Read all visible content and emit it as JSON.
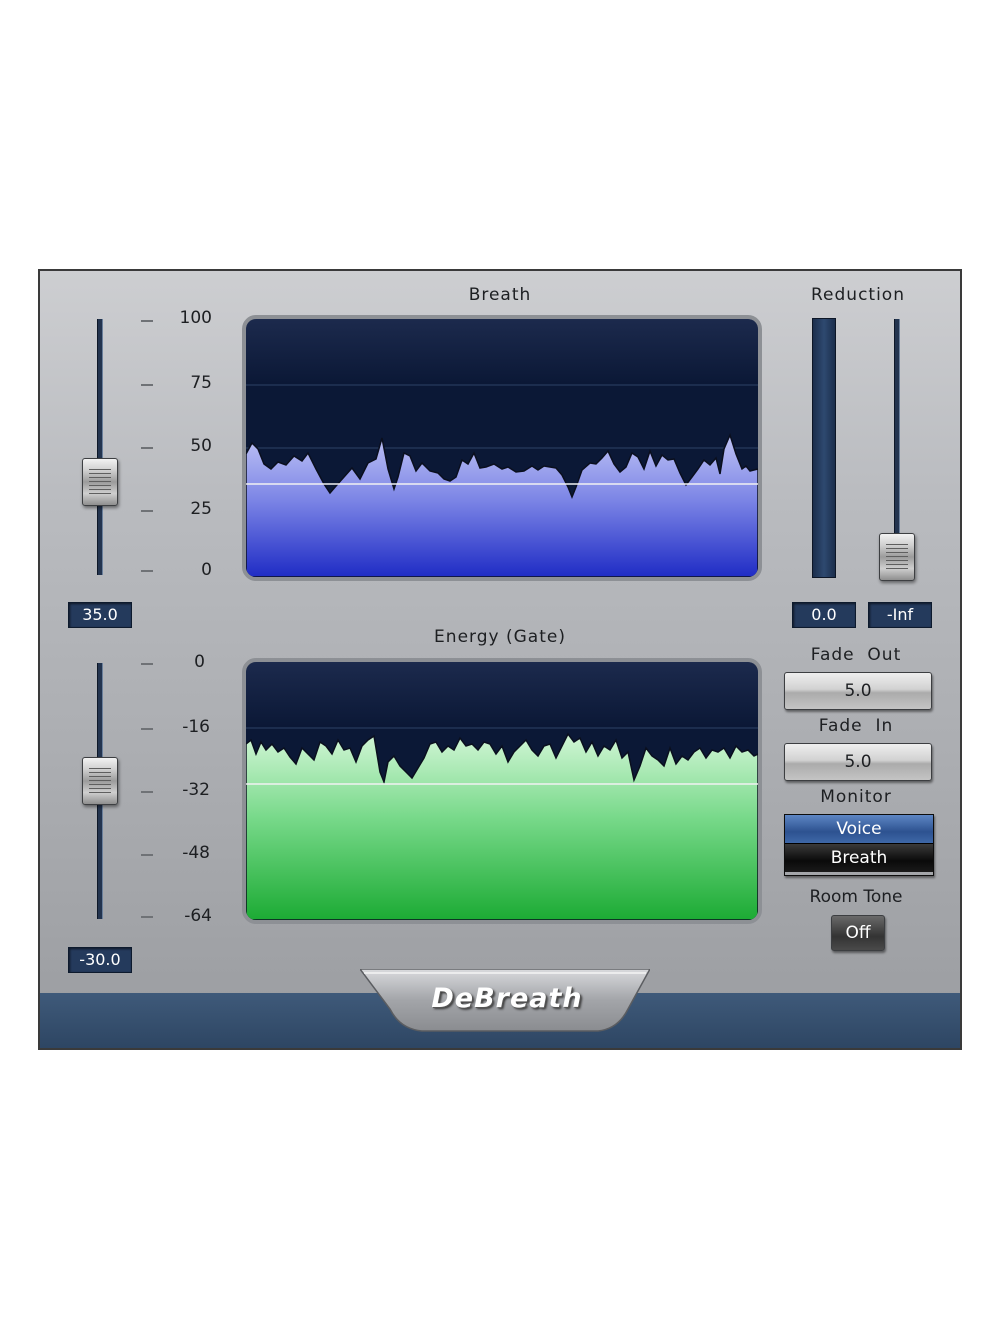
{
  "plugin": {
    "name": "DeBreath"
  },
  "breath": {
    "title": "Breath",
    "ticks": [
      "100",
      "75",
      "50",
      "25",
      "0"
    ],
    "threshold_value": "35.0",
    "threshold_level": 35
  },
  "energy": {
    "title": "Energy (Gate)",
    "ticks": [
      "0",
      "-16",
      "-32",
      "-48",
      "-64"
    ],
    "threshold_value": "-30.0",
    "threshold_level": -30
  },
  "reduction": {
    "title": "Reduction",
    "meter_value": "0.0",
    "slider_value": "-Inf"
  },
  "fade_out": {
    "label": "Fade  Out",
    "value": "5.0"
  },
  "fade_in": {
    "label": "Fade  In",
    "value": "5.0"
  },
  "monitor": {
    "label": "Monitor",
    "options": [
      "Voice",
      "Breath"
    ],
    "selected": "Voice"
  },
  "room_tone": {
    "label": "Room Tone",
    "value": "Off"
  },
  "colors": {
    "breath_fill_top": "#b4b9f2",
    "breath_fill_bottom": "#2330c8",
    "energy_fill_top": "#c9f5cf",
    "energy_fill_bottom": "#22b43a",
    "screen_bg": "#0d1b3a",
    "value_box": "#243a5c"
  }
}
